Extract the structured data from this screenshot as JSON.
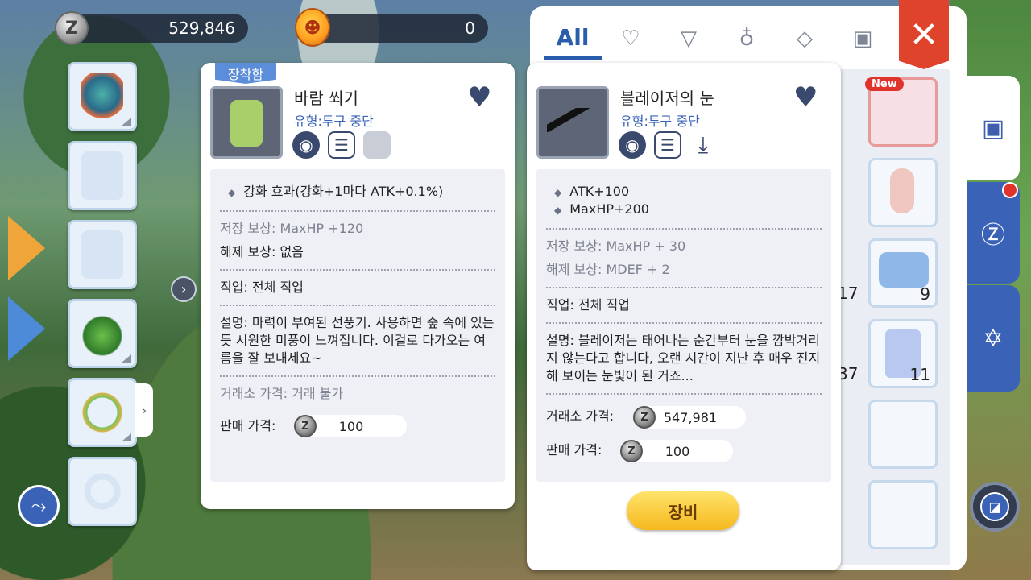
{
  "currency": {
    "zeny_icon_letter": "Z",
    "zeny_amount": "529,846",
    "cash_amount": "0"
  },
  "equip_slots": [
    {
      "icon": "shield-icon"
    },
    {
      "icon": "armor-icon"
    },
    {
      "icon": "cape-icon"
    },
    {
      "icon": "boots-icon"
    },
    {
      "icon": "necklace-icon"
    },
    {
      "icon": "ring-icon"
    }
  ],
  "inventory": {
    "tabs": [
      {
        "name": "tab-all",
        "label": "All"
      },
      {
        "name": "tab-favorites",
        "icon": "heart-outline-icon",
        "glyph": "♡"
      },
      {
        "name": "tab-equipment",
        "icon": "shirt-icon",
        "glyph": "👕"
      },
      {
        "name": "tab-consumables",
        "icon": "potion-icon",
        "glyph": "⚗"
      },
      {
        "name": "tab-cards",
        "icon": "diamond-icon",
        "glyph": "◇"
      },
      {
        "name": "tab-cosmetics",
        "icon": "face-icon",
        "glyph": "☺"
      }
    ],
    "close_glyph": "✕",
    "new_badge": "New",
    "quantities": [
      "17",
      "9",
      "37",
      "11"
    ]
  },
  "card1": {
    "equipped_tag": "장착함",
    "name": "바람 쐬기",
    "type": "유형:투구 중단",
    "effect": "강화 효과(강화+1마다 ATK+0.1%)",
    "store_reward": "저장 보상: MaxHP +120",
    "unlock_reward": "해제 보상: 없음",
    "job": "직업: 전체 직업",
    "description": "설명: 마력이 부여된 선풍기. 사용하면 숲 속에 있는 듯 시원한 미풍이 느껴집니다. 이걸로 다가오는 여름을 잘 보내세요~",
    "exchange_price": "거래소 가격: 거래 불가",
    "sell_label": "판매 가격:",
    "sell_price": "100"
  },
  "card2": {
    "name": "블레이저의 눈",
    "type": "유형:투구 중단",
    "stat1": "ATK+100",
    "stat2": "MaxHP+200",
    "store_reward": "저장 보상: MaxHP + 30",
    "unlock_reward": "해제 보상: MDEF + 2",
    "job": "직업: 전체 직업",
    "description": "설명: 블레이저는 태어나는 순간부터 눈을 깜박거리지 않는다고 합니다, 오랜 시간이 지난 후 매우 진지해 보이는 눈빛이 된 거죠...",
    "exchange_label": "거래소 가격:",
    "exchange_price": "547,981",
    "sell_label": "판매 가격:",
    "sell_price": "100",
    "equip_button": "장비"
  }
}
